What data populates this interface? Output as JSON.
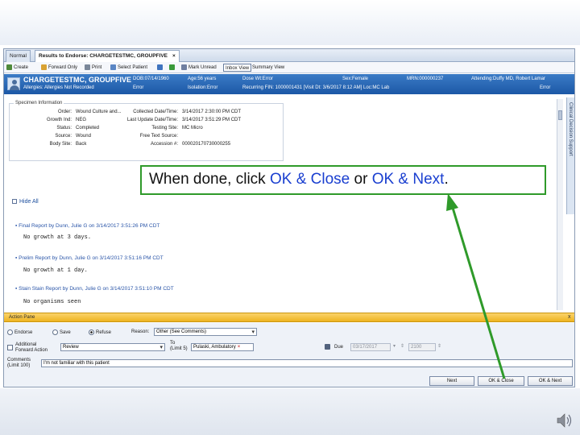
{
  "tabs": [
    {
      "label": "Normal",
      "closable": false
    },
    {
      "label": "Results to Endorse: CHARGETESTMC, GROUPFIVE",
      "closable": true
    }
  ],
  "toolbar": {
    "create": "Create",
    "forward_only": "Forward Only",
    "print": "Print",
    "select_patient": "Select Patient",
    "mark_unread": "Mark Unread",
    "inbox_view": "Inbox View",
    "summary_view": "Summary View"
  },
  "patient": {
    "name": "CHARGETESTMC, GROUPFIVE",
    "allergies": "Allergies: Allergies Not Recorded",
    "dob": "DOB:07/14/1960",
    "age": "Age:56 years",
    "dose_weight": "Dose Wt:Error",
    "sex": "Sex:Female",
    "mrn": "MRN:000000237",
    "attending": "Attending:Duffy MD, Robert Lamar",
    "row2_error1": "Error",
    "isolation": "Isolation:Error",
    "recurring_fin": "Recurring FIN: 1000001431 [Visit Dt: 3/6/2017 8:12 AM]  Loc:MC Lab",
    "row2_error2": "Error"
  },
  "side_strip": "Clinical Decision Support",
  "specimen": {
    "title": "Specimen Information",
    "left_labels": [
      "Order:",
      "Growth Ind:",
      "Status:",
      "Source:",
      "Body Site:"
    ],
    "left_values": [
      "Wound Culture and...",
      "NEG",
      "Completed",
      "Wound",
      "Back"
    ],
    "right_labels": [
      "Collected Date/Time:",
      "Last Update Date/Time:",
      "Testing Site:",
      "Free Text Source:",
      "Accession #:"
    ],
    "right_values": [
      "3/14/2017 2:30:00 PM CDT",
      "3/14/2017 3:51:29 PM CDT",
      "MC Micro",
      "",
      "000020170730000255"
    ]
  },
  "hide_all": "Hide All",
  "reports": [
    {
      "header": "Final Report by Dunn, Julie G on 3/14/2017 3:51:26 PM CDT",
      "body": "No growth at 3 days."
    },
    {
      "header": "Prelim Report by Dunn, Julie G on 3/14/2017 3:51:16 PM CDT",
      "body": "No growth at 1 day."
    },
    {
      "header": "Stain Stain Report by Dunn, Julie G on 3/14/2017 3:51:10 PM CDT",
      "body": "No organisms seen"
    }
  ],
  "action_pane": {
    "title": "Action Pane",
    "endorse": "Endorse",
    "save": "Save",
    "refuse": "Refuse",
    "reason_label": "Reason:",
    "reason_value": "Other (See Comments)",
    "additional_action": "Additional",
    "forward_action": "Forward Action",
    "forward_value": "Review",
    "to_label": "To",
    "limit_label": "(Limit 5)",
    "recipient": "Pulaski, Ambulatory",
    "due_label": "Due",
    "due_date": "03/17/2017",
    "due_time": "2100",
    "comments_label": "Comments",
    "comments_limit": "(Limit 100)",
    "comment_text": "I'm not familiar with this patient",
    "next_button": "Next",
    "ok_close_button": "OK & Close",
    "ok_next_button": "OK & Next",
    "close_glyph": "x"
  },
  "instruction": {
    "prefix": "When done, click ",
    "ok_close": "OK & Close",
    "middle": " or ",
    "ok_next": "OK & Next",
    "suffix": "."
  },
  "colors": {
    "banner": "#1c58a6",
    "action_header": "#eeb321",
    "callout_border": "#2f9a2a",
    "highlight_text": "#1a3fd0"
  }
}
